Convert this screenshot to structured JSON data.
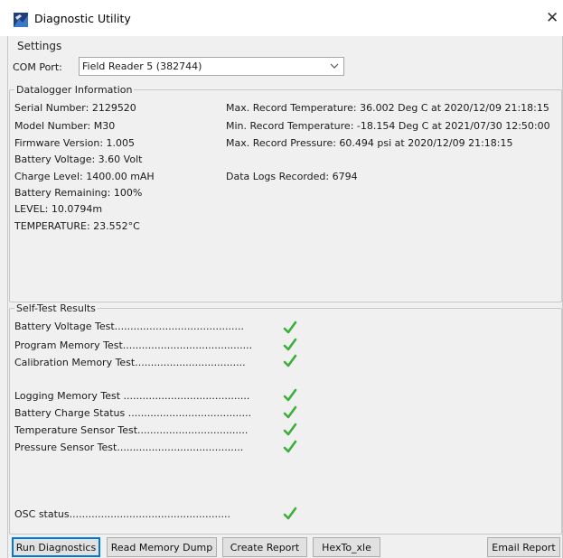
{
  "window": {
    "title": "Diagnostic Utility",
    "close_glyph": "X"
  },
  "settings": {
    "label": "Settings",
    "com_port_label": "COM Port:",
    "com_port_value": "Field Reader 5 (382744)"
  },
  "datalogger": {
    "title": "Datalogger Information",
    "left": [
      "Serial Number: 2129520",
      "Model Number: M30",
      "Firmware Version: 1.005",
      "Battery Voltage: 3.60 Volt",
      "Charge Level: 1400.00 mAH",
      "Battery Remaining: 100%",
      "LEVEL: 10.0794m",
      "TEMPERATURE: 23.552°C"
    ],
    "right": [
      "Max. Record Temperature: 36.002 Deg C at 2020/12/09 21:18:15",
      "Min. Record Temperature: -18.154 Deg C at 2021/07/30 12:50:00",
      "Max. Record Pressure: 60.494 psi at 2020/12/09 21:18:15",
      "Data Logs Recorded: 6794"
    ]
  },
  "selftest": {
    "title": "Self-Test Results",
    "tests": [
      {
        "label": "Battery Voltage Test.........................................",
        "status": "pass"
      },
      {
        "label": "Program Memory Test.........................................",
        "status": "pass"
      },
      {
        "label": "Calibration Memory Test...................................",
        "status": "pass"
      },
      {
        "label": "Logging Memory Test ........................................",
        "status": "pass"
      },
      {
        "label": "Battery Charge Status .......................................",
        "status": "pass"
      },
      {
        "label": "Temperature Sensor Test...................................",
        "status": "pass"
      },
      {
        "label": "Pressure Sensor Test........................................",
        "status": "pass"
      },
      {
        "label": "OSC status...................................................",
        "status": "pass"
      }
    ]
  },
  "buttons": {
    "run": "Run Diagnostics",
    "dump": "Read Memory Dump",
    "report": "Create Report",
    "hex": "HexTo_xle",
    "email": "Email Report"
  },
  "colors": {
    "check": "#3cae3c",
    "accent": "#0078d7"
  },
  "icons": {
    "app": "app-logo-icon",
    "check": "check-icon",
    "dropdown": "chevron-down-icon"
  }
}
